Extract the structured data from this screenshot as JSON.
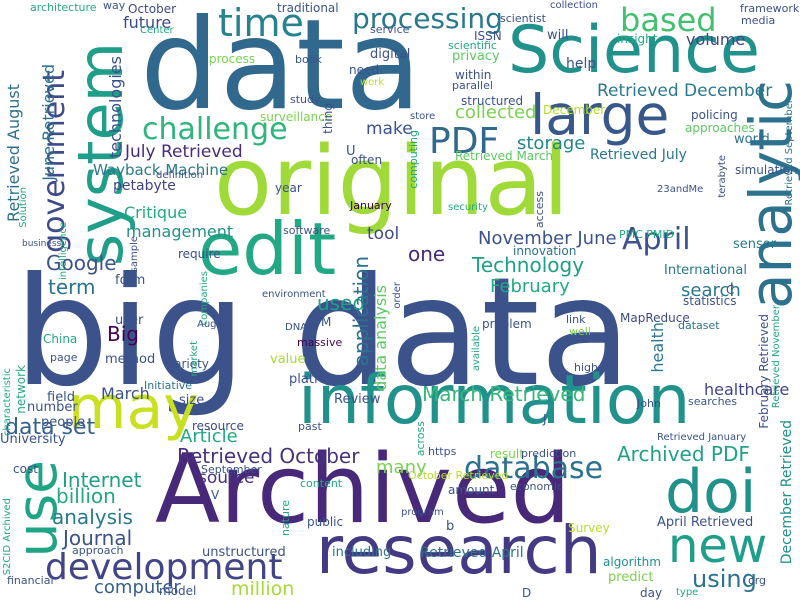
{
  "words": [
    {
      "text": "big data",
      "color": "#3b528b"
    },
    {
      "text": "data",
      "color": "#31688e"
    },
    {
      "text": "original",
      "color": "#a0da39"
    },
    {
      "text": "Archived",
      "color": "#482878"
    },
    {
      "text": "information",
      "color": "#21918c"
    },
    {
      "text": "research",
      "color": "#443983"
    },
    {
      "text": "Science",
      "color": "#21918c"
    },
    {
      "text": "system",
      "color": "#1f9e89"
    },
    {
      "text": "analytic",
      "color": "#2c728e"
    },
    {
      "text": "edit",
      "color": "#22a884"
    },
    {
      "text": "large",
      "color": "#38588c"
    },
    {
      "text": "may",
      "color": "#c8e020"
    },
    {
      "text": "doi",
      "color": "#21918c"
    },
    {
      "text": "use",
      "color": "#20a486"
    },
    {
      "text": "new",
      "color": "#1f9e89"
    },
    {
      "text": "development",
      "color": "#414487"
    },
    {
      "text": "time",
      "color": "#26828e"
    },
    {
      "text": "processing",
      "color": "#2a788e"
    },
    {
      "text": "based",
      "color": "#44bf70"
    },
    {
      "text": "challenge",
      "color": "#2fb47c"
    },
    {
      "text": "PDF",
      "color": "#31688e"
    },
    {
      "text": "government",
      "color": "#3e4a89"
    },
    {
      "text": "database",
      "color": "#2c728e"
    },
    {
      "text": "April",
      "color": "#3b528b"
    },
    {
      "text": "Retrieved October",
      "color": "#46337e"
    },
    {
      "text": "March Retrieved",
      "color": "#35b779"
    },
    {
      "text": "Archived PDF",
      "color": "#1fa187"
    },
    {
      "text": "using",
      "color": "#2c728e"
    },
    {
      "text": "Technology",
      "color": "#1f9e89"
    },
    {
      "text": "July Retrieved",
      "color": "#472c7a"
    },
    {
      "text": "storage",
      "color": "#25858e"
    },
    {
      "text": "volume",
      "color": "#3f4788"
    },
    {
      "text": "Retrieved December",
      "color": "#2a788e"
    },
    {
      "text": "management",
      "color": "#21918c"
    },
    {
      "text": "Google",
      "color": "#3b528b"
    },
    {
      "text": "term",
      "color": "#2c728e"
    },
    {
      "text": "tool",
      "color": "#3e4989"
    },
    {
      "text": "one",
      "color": "#482878"
    },
    {
      "text": "November June",
      "color": "#3b528b"
    },
    {
      "text": "Critique",
      "color": "#22a884"
    },
    {
      "text": "Wayback Machine",
      "color": "#2a788e"
    },
    {
      "text": "data set",
      "color": "#355f8d"
    },
    {
      "text": "Internet",
      "color": "#1f9e89"
    },
    {
      "text": "billion",
      "color": "#22a884"
    },
    {
      "text": "analysis",
      "color": "#2a788e"
    },
    {
      "text": "Journal",
      "color": "#3b528b"
    },
    {
      "text": "computer",
      "color": "#355f8d"
    },
    {
      "text": "million",
      "color": "#a5db36"
    },
    {
      "text": "Article",
      "color": "#22a884"
    },
    {
      "text": "source",
      "color": "#46327e"
    },
    {
      "text": "many",
      "color": "#7ad151"
    },
    {
      "text": "Big",
      "color": "#440154"
    },
    {
      "text": "March",
      "color": "#3b528b"
    },
    {
      "text": "used",
      "color": "#1f9e89"
    },
    {
      "text": "search",
      "color": "#2a788e"
    },
    {
      "text": "February",
      "color": "#22a884"
    },
    {
      "text": "application",
      "color": "#2c728e"
    },
    {
      "text": "data analysis",
      "color": "#5ec962"
    },
    {
      "text": "make",
      "color": "#3b528b"
    },
    {
      "text": "collected",
      "color": "#7ad151"
    },
    {
      "text": "Retrieved August",
      "color": "#2d708e"
    },
    {
      "text": "June Retrieved",
      "color": "#2c728e"
    },
    {
      "text": "technologies",
      "color": "#3b528b"
    },
    {
      "text": "future",
      "color": "#3e4a89"
    },
    {
      "text": "October",
      "color": "#3e4a89"
    },
    {
      "text": "Retrieved March",
      "color": "#5ec962"
    },
    {
      "text": "Retrieved July",
      "color": "#2a788e"
    },
    {
      "text": "petabyte",
      "color": "#414487"
    },
    {
      "text": "year",
      "color": "#3b528b"
    },
    {
      "text": "January",
      "color": "#440154"
    },
    {
      "text": "health",
      "color": "#2a788e"
    },
    {
      "text": "healthcare",
      "color": "#414487"
    },
    {
      "text": "Retrieved April",
      "color": "#2c728e"
    },
    {
      "text": "April Retrieved",
      "color": "#3b528b"
    },
    {
      "text": "December Retrieved",
      "color": "#21918c"
    },
    {
      "text": "Survey",
      "color": "#b5de2b"
    },
    {
      "text": "algorithm",
      "color": "#21918c"
    },
    {
      "text": "predict",
      "color": "#7ad151"
    },
    {
      "text": "day",
      "color": "#3b528b"
    },
    {
      "text": "unstructured",
      "color": "#3b528b"
    },
    {
      "text": "including",
      "color": "#2c728e"
    },
    {
      "text": "Review",
      "color": "#3b528b"
    },
    {
      "text": "platform",
      "color": "#3b528b"
    },
    {
      "text": "resource",
      "color": "#3e4a89"
    },
    {
      "text": "size",
      "color": "#3b528b"
    },
    {
      "text": "Initiative",
      "color": "#2c728e"
    },
    {
      "text": "method",
      "color": "#3b528b"
    },
    {
      "text": "value",
      "color": "#a5db36"
    },
    {
      "text": "massive",
      "color": "#440154"
    },
    {
      "text": "International",
      "color": "#2a788e"
    },
    {
      "text": "statistics",
      "color": "#3b528b"
    },
    {
      "text": "sensor",
      "color": "#2a788e"
    },
    {
      "text": "innovation",
      "color": "#2c728e"
    },
    {
      "text": "problem",
      "color": "#3b528b"
    },
    {
      "text": "policing",
      "color": "#3b528b"
    },
    {
      "text": "approaches",
      "color": "#5ec962"
    },
    {
      "text": "world",
      "color": "#2c728e"
    },
    {
      "text": "simulation",
      "color": "#3b528b"
    },
    {
      "text": "terabyte",
      "color": "#3b528b"
    },
    {
      "text": "MapReduce",
      "color": "#3e4a89"
    },
    {
      "text": "dataset",
      "color": "#2c728e"
    },
    {
      "text": "February Retrieved",
      "color": "#3b528b"
    },
    {
      "text": "Retrieved November",
      "color": "#22a884"
    },
    {
      "text": "Retrieved September",
      "color": "#2c728e"
    },
    {
      "text": "framework",
      "color": "#3b528b"
    },
    {
      "text": "media",
      "color": "#3b528b"
    },
    {
      "text": "insight",
      "color": "#22a884"
    },
    {
      "text": "help",
      "color": "#3b528b"
    },
    {
      "text": "scientist",
      "color": "#3b528b"
    },
    {
      "text": "will",
      "color": "#3b528b"
    },
    {
      "text": "privacy",
      "color": "#5ec962"
    },
    {
      "text": "scientific",
      "color": "#22a884"
    },
    {
      "text": "ISSN",
      "color": "#3b528b"
    },
    {
      "text": "collection",
      "color": "#3e4a89"
    },
    {
      "text": "traditional",
      "color": "#3b528b"
    },
    {
      "text": "architecture",
      "color": "#22a884"
    },
    {
      "text": "way",
      "color": "#3b528b"
    },
    {
      "text": "service",
      "color": "#3b528b"
    },
    {
      "text": "digital",
      "color": "#3b528b"
    },
    {
      "text": "need",
      "color": "#3b528b"
    },
    {
      "text": "work",
      "color": "#b5de2b"
    },
    {
      "text": "within",
      "color": "#3b528b"
    },
    {
      "text": "parallel",
      "color": "#3b528b"
    },
    {
      "text": "structured",
      "color": "#3b528b"
    },
    {
      "text": "store",
      "color": "#3b528b"
    },
    {
      "text": "process",
      "color": "#7ad151"
    },
    {
      "text": "book",
      "color": "#3b528b"
    },
    {
      "text": "study",
      "color": "#3b528b"
    },
    {
      "text": "surveillance",
      "color": "#7ad151"
    },
    {
      "text": "thing",
      "color": "#3b528b"
    },
    {
      "text": "often",
      "color": "#3b528b"
    },
    {
      "text": "computing",
      "color": "#22a884"
    },
    {
      "text": "access",
      "color": "#3b528b"
    },
    {
      "text": "security",
      "color": "#22a884"
    },
    {
      "text": "definition",
      "color": "#3b528b"
    },
    {
      "text": "software",
      "color": "#3b528b"
    },
    {
      "text": "require",
      "color": "#3b528b"
    },
    {
      "text": "companies",
      "color": "#22a884"
    },
    {
      "text": "environment",
      "color": "#3b528b"
    },
    {
      "text": "DNA",
      "color": "#3b528b"
    },
    {
      "text": "page",
      "color": "#3b528b"
    },
    {
      "text": "China",
      "color": "#22a884"
    },
    {
      "text": "variety",
      "color": "#3b528b"
    },
    {
      "text": "form",
      "color": "#3b528b"
    },
    {
      "text": "user",
      "color": "#3b528b"
    },
    {
      "text": "field",
      "color": "#3b528b"
    },
    {
      "text": "number",
      "color": "#3b528b"
    },
    {
      "text": "people",
      "color": "#3b528b"
    },
    {
      "text": "University",
      "color": "#3b528b"
    },
    {
      "text": "cost",
      "color": "#3b528b"
    },
    {
      "text": "financial",
      "color": "#3b528b"
    },
    {
      "text": "model",
      "color": "#3b528b"
    },
    {
      "text": "approach",
      "color": "#3b528b"
    },
    {
      "text": "nature",
      "color": "#22a884"
    },
    {
      "text": "public",
      "color": "#3b528b"
    },
    {
      "text": "content",
      "color": "#22a884"
    },
    {
      "text": "past",
      "color": "#3b528b"
    },
    {
      "text": "https",
      "color": "#3b528b"
    },
    {
      "text": "result",
      "color": "#7ad151"
    },
    {
      "text": "prediction",
      "color": "#3b528b"
    },
    {
      "text": "economic",
      "color": "#3b528b"
    },
    {
      "text": "amount",
      "color": "#3b528b"
    },
    {
      "text": "program",
      "color": "#3b528b"
    },
    {
      "text": "order",
      "color": "#3b528b"
    },
    {
      "text": "link",
      "color": "#3b528b"
    },
    {
      "text": "well",
      "color": "#7ad151"
    },
    {
      "text": "high",
      "color": "#3b528b"
    },
    {
      "text": "John",
      "color": "#3b528b"
    },
    {
      "text": "searches",
      "color": "#3b528b"
    },
    {
      "text": "available",
      "color": "#22a884"
    },
    {
      "text": "network",
      "color": "#22a884"
    },
    {
      "text": "characteristic",
      "color": "#22a884"
    },
    {
      "text": "S2CID Archived",
      "color": "#22a884"
    },
    {
      "text": "Retrieved January",
      "color": "#3b528b"
    },
    {
      "text": "PMC PMID",
      "color": "#22a884"
    },
    {
      "text": "23andMe",
      "color": "#3b528b"
    },
    {
      "text": "Center",
      "color": "#22a884"
    },
    {
      "text": "Solution",
      "color": "#22a884"
    },
    {
      "text": "intelligence",
      "color": "#22a884"
    },
    {
      "text": "business",
      "color": "#3b528b"
    },
    {
      "text": "sample",
      "color": "#3b528b"
    },
    {
      "text": "across",
      "color": "#22a884"
    },
    {
      "text": "market",
      "color": "#22a884"
    },
    {
      "text": "org",
      "color": "#3b528b"
    },
    {
      "text": "type",
      "color": "#22a884"
    },
    {
      "text": "September",
      "color": "#3b528b"
    },
    {
      "text": "October Retrieved",
      "color": "#b5de2b"
    },
    {
      "text": "August",
      "color": "#3b528b"
    },
    {
      "text": "December",
      "color": "#b5de2b"
    },
    {
      "text": "U",
      "color": "#3b528b"
    },
    {
      "text": "M",
      "color": "#3b528b"
    },
    {
      "text": "V",
      "color": "#3b528b"
    },
    {
      "text": "b",
      "color": "#3b528b"
    },
    {
      "text": "D",
      "color": "#3b528b"
    },
    {
      "text": "J",
      "color": "#3b528b"
    },
    {
      "text": "C",
      "color": "#3b528b"
    },
    {
      "text": "S",
      "color": "#3b528b"
    }
  ]
}
